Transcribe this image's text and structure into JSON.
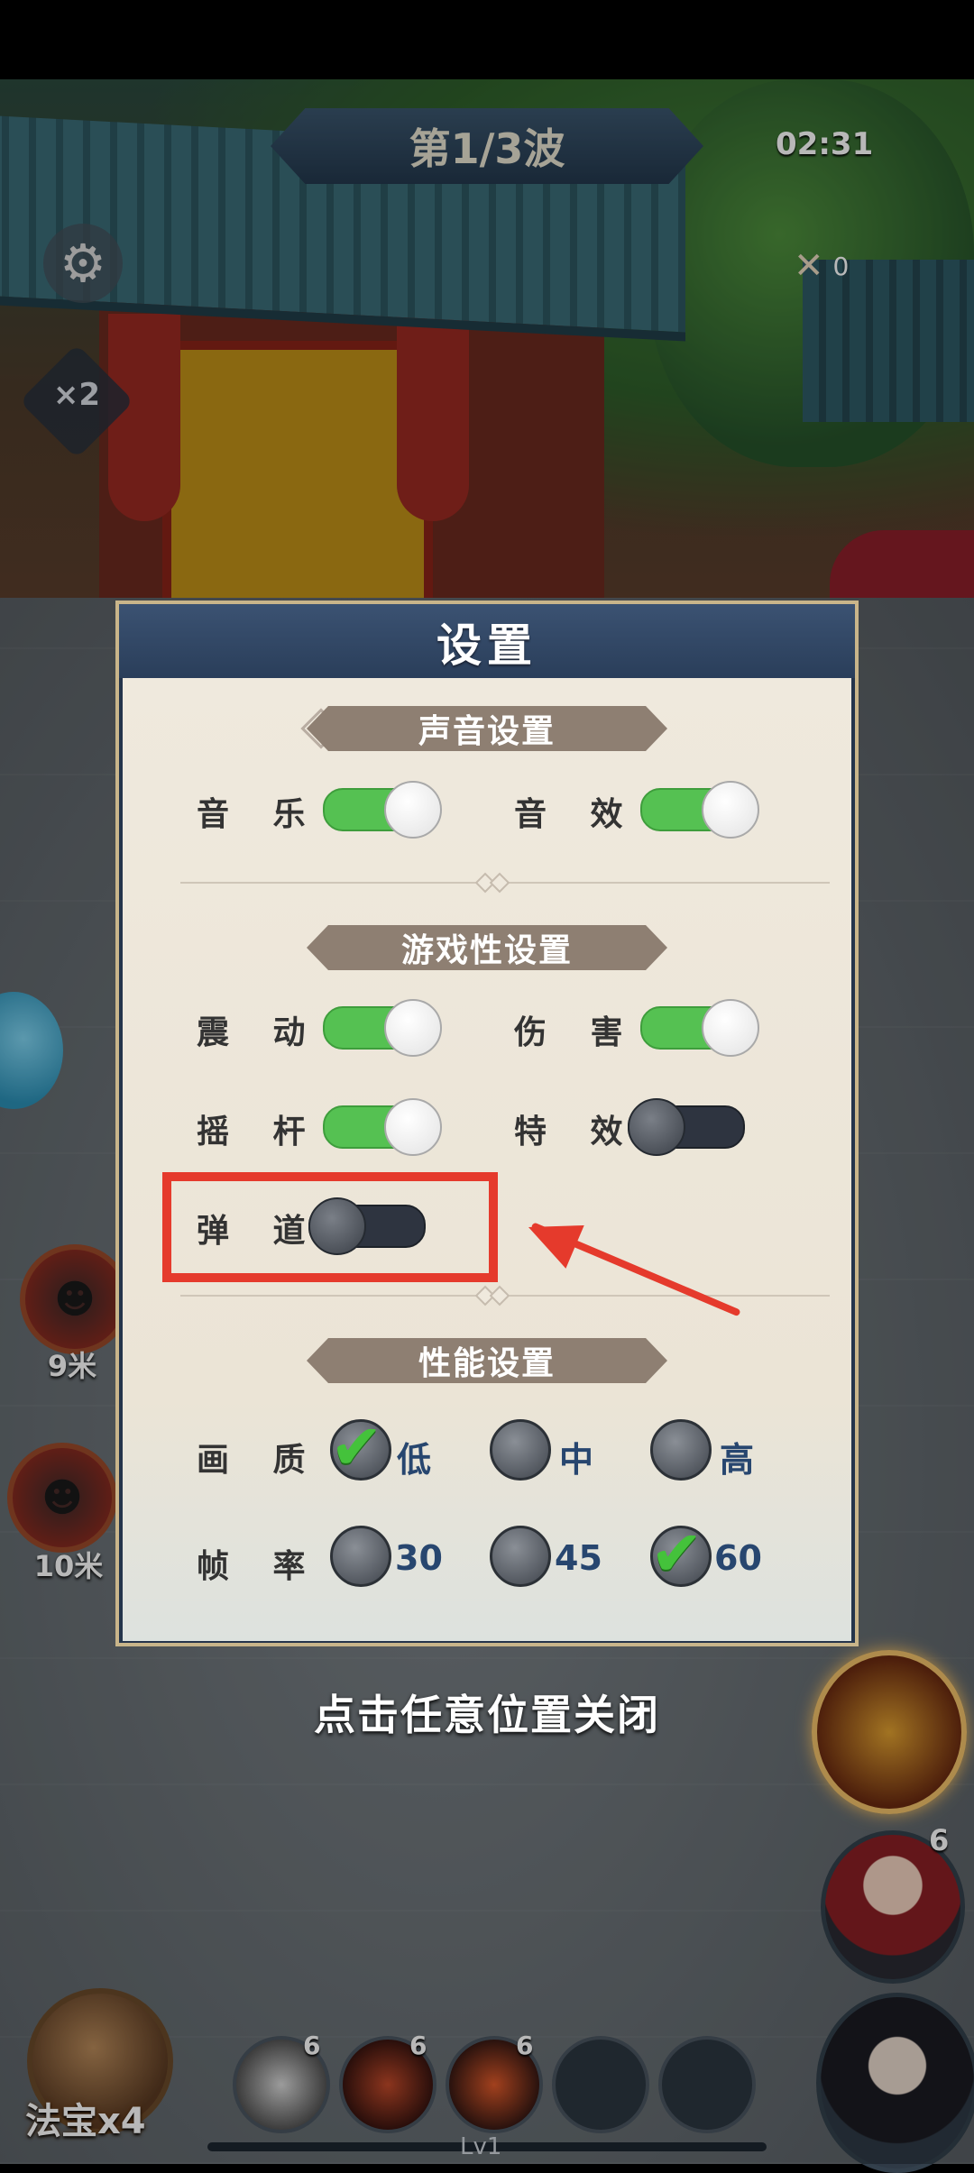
{
  "hud": {
    "wave": "第1/3波",
    "timer": "02:31",
    "kills": "0",
    "speed": "×2"
  },
  "enemies": [
    {
      "distance": "9米"
    },
    {
      "distance": "10米"
    }
  ],
  "settings": {
    "title": "设置",
    "sound": {
      "section": "声音设置",
      "music": {
        "label": "音 乐",
        "on": true
      },
      "sfx": {
        "label": "音 效",
        "on": true
      }
    },
    "gameplay": {
      "section": "游戏性设置",
      "vibration": {
        "label": "震 动",
        "on": true
      },
      "damage": {
        "label": "伤 害",
        "on": true
      },
      "joystick": {
        "label": "摇 杆",
        "on": true
      },
      "effects": {
        "label": "特 效",
        "on": false
      },
      "trajectory": {
        "label": "弹 道",
        "on": false
      }
    },
    "performance": {
      "section": "性能设置",
      "quality": {
        "label": "画 质",
        "options": [
          "低",
          "中",
          "高"
        ],
        "selected": "低"
      },
      "framerate": {
        "label": "帧 率",
        "options": [
          "30",
          "45",
          "60"
        ],
        "selected": "60"
      }
    },
    "close_hint": "点击任意位置关闭"
  },
  "bottom": {
    "magic": "法宝x4",
    "skills": [
      {
        "count": "6"
      },
      {
        "count": "6"
      },
      {
        "count": "6"
      }
    ],
    "level": "Lv1",
    "hero_count": "6"
  },
  "colors": {
    "toggle_on": "#55c152",
    "toggle_off": "#2e3440",
    "annotation": "#e53a2c"
  }
}
